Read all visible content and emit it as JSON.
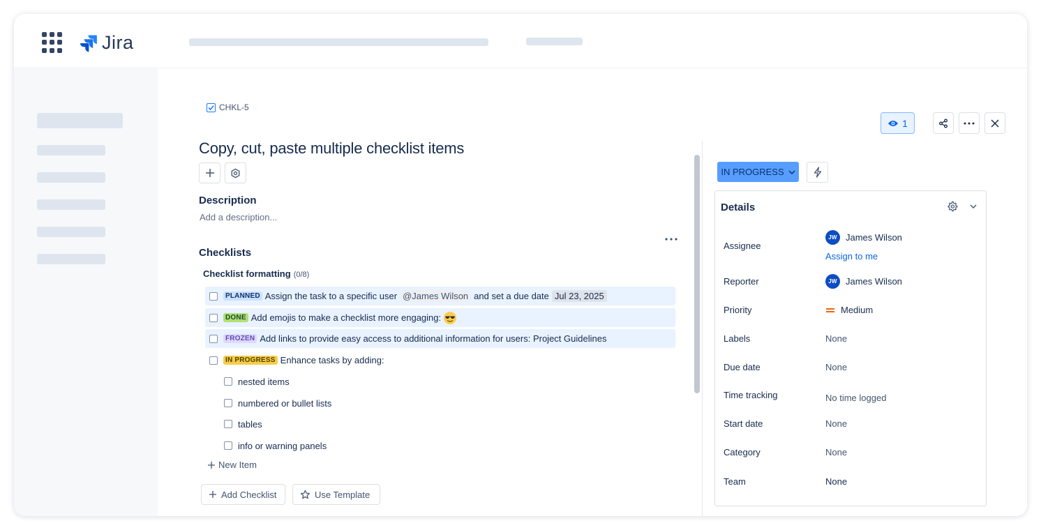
{
  "app": {
    "name": "Jira"
  },
  "issue": {
    "key": "CHKL-5",
    "title": "Copy, cut, paste multiple checklist items",
    "watchers": "1"
  },
  "description": {
    "heading": "Description",
    "placeholder": "Add a description..."
  },
  "checklists": {
    "heading": "Checklists",
    "name": "Checklist formatting",
    "count": "(0/8)",
    "items": [
      {
        "status": "PLANNED",
        "status_bg": "#cce0ff",
        "status_color": "#09326c",
        "text": "Assign the task to a specific user",
        "mention": "@James Wilson",
        "text2": "and set a due date",
        "date": "Jul 23, 2025"
      },
      {
        "status": "DONE",
        "status_bg": "#b3df72",
        "status_color": "#164b35",
        "text": "Add emojis to make a checklist more engaging:",
        "emoji": "sunglasses-emoji"
      },
      {
        "status": "FROZEN",
        "status_bg": "#dfd8fd",
        "status_color": "#5e4db2",
        "text": "Add links to provide easy access to additional information for users: Project Guidelines"
      },
      {
        "status": "IN PROGRESS",
        "status_bg": "#f5cd47",
        "status_color": "#533f04",
        "text": "Enhance tasks by adding:"
      }
    ],
    "sub_items": [
      "nested items",
      "numbered or bullet lists",
      "tables",
      "info or warning panels"
    ],
    "new_item": "New Item",
    "add_checklist": "Add Checklist",
    "use_template": "Use Template"
  },
  "status": {
    "label": "IN PROGRESS",
    "color": "#579dff"
  },
  "details": {
    "heading": "Details",
    "assignee": {
      "label": "Assignee",
      "initials": "JW",
      "name": "James Wilson",
      "assign_to_me": "Assign to me"
    },
    "reporter": {
      "label": "Reporter",
      "initials": "JW",
      "name": "James Wilson"
    },
    "priority": {
      "label": "Priority",
      "value": "Medium",
      "color": "#e56910"
    },
    "labels": {
      "label": "Labels",
      "value": "None"
    },
    "due_date": {
      "label": "Due date",
      "value": "None"
    },
    "time_tracking": {
      "label": "Time tracking",
      "value": "No time logged"
    },
    "start_date": {
      "label": "Start date",
      "value": "None"
    },
    "category": {
      "label": "Category",
      "value": "None"
    },
    "team": {
      "label": "Team",
      "value": "None"
    }
  }
}
